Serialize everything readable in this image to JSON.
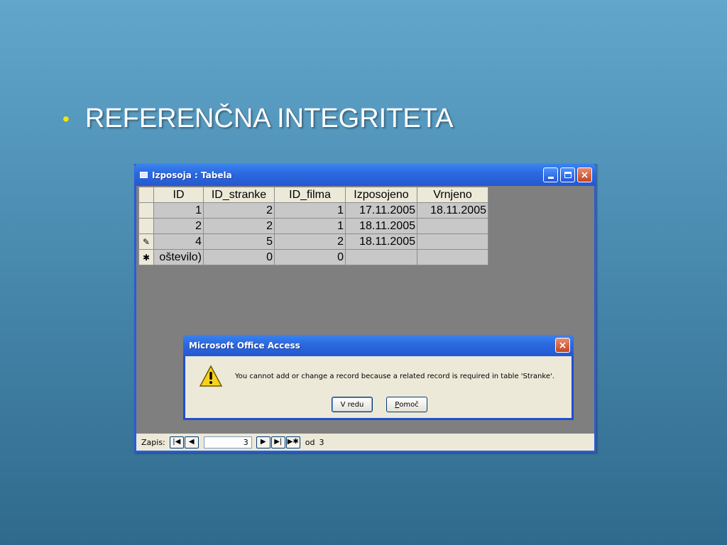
{
  "slide": {
    "bullet": "•",
    "title": "REFERENČNA INTEGRITETA"
  },
  "window": {
    "title": "Izposoja : Tabela",
    "buttons": {
      "minimize": "minimize-icon",
      "maximize": "maximize-icon",
      "close": "×"
    }
  },
  "table": {
    "columns": [
      "ID",
      "ID_stranke",
      "ID_filma",
      "Izposojeno",
      "Vrnjeno"
    ],
    "rows": [
      {
        "selector": "",
        "cells": [
          "1",
          "2",
          "1",
          "17.11.2005",
          "18.11.2005"
        ]
      },
      {
        "selector": "",
        "cells": [
          "2",
          "2",
          "1",
          "18.11.2005",
          ""
        ]
      },
      {
        "selector": "✎",
        "cells": [
          "4",
          "5",
          "2",
          "18.11.2005",
          ""
        ]
      },
      {
        "selector": "✱",
        "cells": [
          "oštevilo)",
          "0",
          "0",
          "",
          ""
        ]
      }
    ]
  },
  "navbar": {
    "label": "Zapis:",
    "first": "|◀",
    "prev": "◀",
    "current": "3",
    "next": "▶",
    "last": "▶|",
    "new": "▶✱",
    "of_label": "od",
    "total": "3"
  },
  "dialog": {
    "title": "Microsoft Office Access",
    "close": "×",
    "icon": "warning-icon",
    "message": "You cannot add or change a record because a related record is required in table 'Stranke'.",
    "ok_label": "V redu",
    "help_label_accel": "P",
    "help_label_rest": "omoč"
  }
}
